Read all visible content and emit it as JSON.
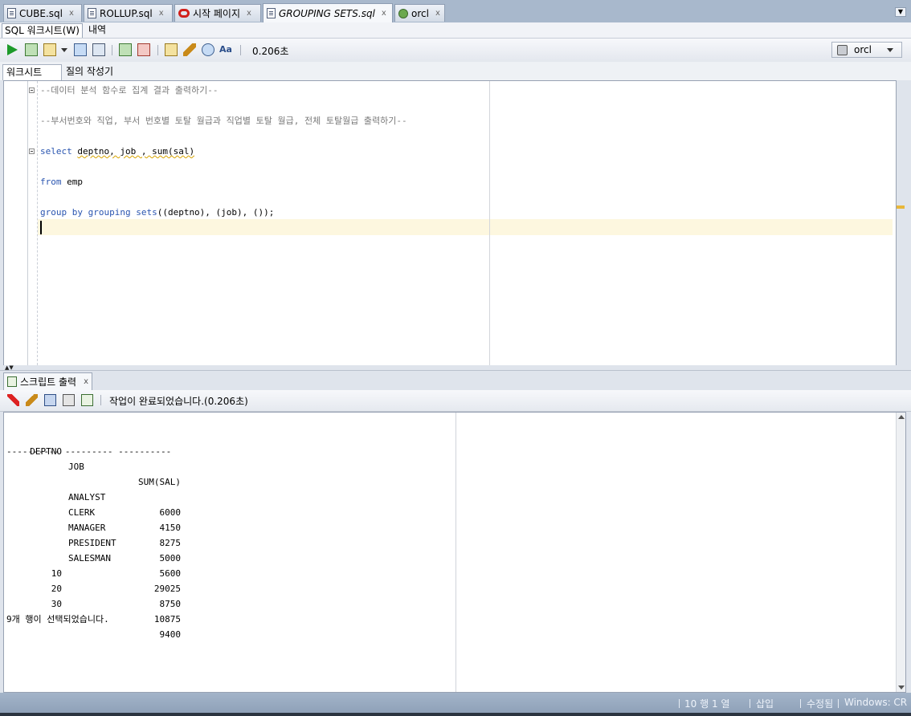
{
  "editor_tabs": [
    {
      "label": "CUBE.sql",
      "icon": "sql-file-icon"
    },
    {
      "label": "ROLLUP.sql",
      "icon": "sql-file-icon"
    },
    {
      "label": "시작 페이지",
      "icon": "oracle-logo-icon"
    },
    {
      "label": "GROUPING SETS.sql",
      "icon": "sql-file-icon",
      "active": true
    },
    {
      "label": "orcl",
      "icon": "connection-icon"
    }
  ],
  "sub_tabs": [
    "SQL 워크시트(W)",
    "내역"
  ],
  "toolbar": {
    "timing": "0.206초",
    "connection": "orcl"
  },
  "inner_tabs": [
    "워크시트",
    "질의 작성기"
  ],
  "editor": {
    "comment1": "--데이터 분석 함수로 집계 결과 출력하기--",
    "comment2": "--부서번호와 직업, 부서 번호별 토탈 월급과 직업별 토탈 월급, 전체 토탈월급 출력하기--",
    "select_kw": "select",
    "select_cols": "deptno, job , sum(sal)",
    "from_kw": "from",
    "from_table": "emp",
    "group_kw": "group by grouping sets",
    "group_args": "((deptno), (job), ());",
    "current_line": 10
  },
  "output": {
    "tab_label": "스크립트 출력",
    "status": "작업이 완료되었습니다.(0.206초)",
    "columns": [
      "DEPTNO",
      "JOB",
      "SUM(SAL)"
    ],
    "underline": "---------- --------- ----------",
    "rows": [
      {
        "deptno": "",
        "job": "ANALYST",
        "sum": "6000"
      },
      {
        "deptno": "",
        "job": "CLERK",
        "sum": "4150"
      },
      {
        "deptno": "",
        "job": "MANAGER",
        "sum": "8275"
      },
      {
        "deptno": "",
        "job": "PRESIDENT",
        "sum": "5000"
      },
      {
        "deptno": "",
        "job": "SALESMAN",
        "sum": "5600"
      },
      {
        "deptno": "",
        "job": "",
        "sum": "29025"
      },
      {
        "deptno": "10",
        "job": "",
        "sum": "8750"
      },
      {
        "deptno": "20",
        "job": "",
        "sum": "10875"
      },
      {
        "deptno": "30",
        "job": "",
        "sum": "9400"
      }
    ],
    "footer": "9개 행이 선택되었습니다."
  },
  "statusbar": {
    "position": "10 행 1 열",
    "mode": "삽입",
    "modified": "수정됨",
    "eol": "Windows: CR"
  }
}
